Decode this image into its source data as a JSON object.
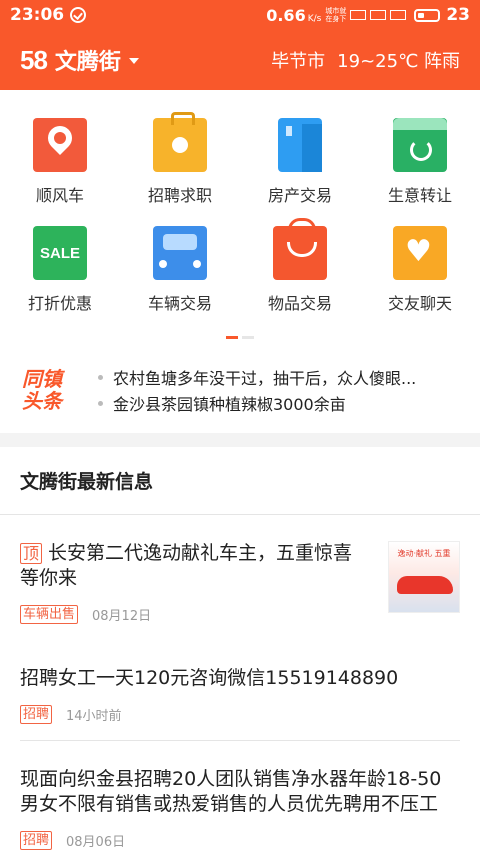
{
  "status_bar": {
    "time": "23:06",
    "speed": "0.66",
    "speed_unit": "K/s",
    "net_small": "城市就\n在身下",
    "battery": "23"
  },
  "title_bar": {
    "logo": "58",
    "city": "文腾街",
    "location": "毕节市",
    "weather": "19~25℃ 阵雨"
  },
  "grid": [
    {
      "label": "顺风车",
      "icon": "car-pin-icon"
    },
    {
      "label": "招聘求职",
      "icon": "briefcase-icon"
    },
    {
      "label": "房产交易",
      "icon": "building-icon"
    },
    {
      "label": "生意转让",
      "icon": "transfer-icon"
    },
    {
      "label": "打折优惠",
      "icon": "sale-icon",
      "text": "SALE"
    },
    {
      "label": "车辆交易",
      "icon": "vehicle-icon"
    },
    {
      "label": "物品交易",
      "icon": "shopping-bag-icon"
    },
    {
      "label": "交友聊天",
      "icon": "heart-icon"
    }
  ],
  "headlines": {
    "logo": "同镇\n头条",
    "items": [
      "农村鱼塘多年没干过，抽干后，众人傻眼...",
      "金沙县茶园镇种植辣椒3000余亩"
    ]
  },
  "section_title": "文腾街最新信息",
  "posts": [
    {
      "top_badge": "顶",
      "title": "长安第二代逸动献礼车主，五重惊喜等你来",
      "tag": "车辆出售",
      "time": "08月12日",
      "thumb_text": "逸动·献礼 五重"
    },
    {
      "title": "招聘女工一天120元咨询微信15519148890",
      "tag": "招聘",
      "time": "14小时前"
    },
    {
      "title": "现面向织金县招聘20人团队销售净水器年龄18-50男女不限有销售或热爱销售的人员优先聘用不压工",
      "tag": "招聘",
      "time": "08月06日"
    }
  ],
  "colors": {
    "accent": "#f9582b"
  }
}
